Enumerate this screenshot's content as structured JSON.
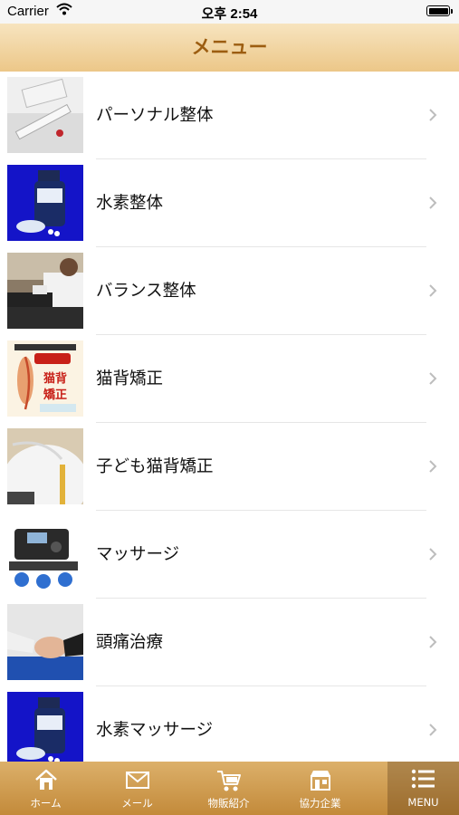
{
  "status_bar": {
    "carrier": "Carrier",
    "time": "오후 2:54"
  },
  "header": {
    "title": "メニュー"
  },
  "menu_items": [
    {
      "label": "パーソナル整体",
      "thumb_icon": "personal-seitai-photo"
    },
    {
      "label": "水素整体",
      "thumb_icon": "hydrogen-bottle-photo"
    },
    {
      "label": "バランス整体",
      "thumb_icon": "balance-treatment-photo"
    },
    {
      "label": "猫背矯正",
      "thumb_icon": "posture-poster-photo",
      "thumb_text": [
        "猫背",
        "矯正"
      ]
    },
    {
      "label": "子ども猫背矯正",
      "thumb_icon": "child-posture-photo"
    },
    {
      "label": "マッサージ",
      "thumb_icon": "massage-device-photo"
    },
    {
      "label": "頭痛治療",
      "thumb_icon": "headache-treatment-photo"
    },
    {
      "label": "水素マッサージ",
      "thumb_icon": "hydrogen-bottle-photo"
    }
  ],
  "tabs": [
    {
      "label": "ホーム",
      "icon": "home-icon"
    },
    {
      "label": "メール",
      "icon": "mail-icon"
    },
    {
      "label": "物販紹介",
      "icon": "cart-icon"
    },
    {
      "label": "協力企業",
      "icon": "shop-icon"
    },
    {
      "label": "MENU",
      "icon": "menu-icon",
      "active": true
    }
  ],
  "colors": {
    "header_gradient_top": "#f7e4bf",
    "header_gradient_bottom": "#ecc788",
    "header_text": "#9c5d10",
    "tabbar_top": "#dcb06a",
    "tabbar_bottom": "#c38a3a"
  }
}
